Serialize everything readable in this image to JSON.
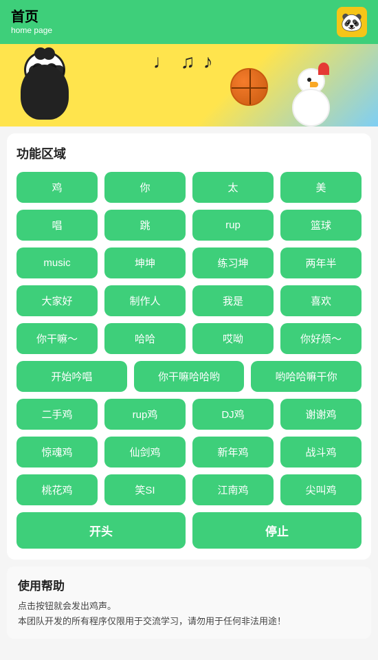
{
  "header": {
    "title_zh": "首页",
    "subtitle": "home page",
    "logo_emoji": "🐼"
  },
  "function_section": {
    "title": "功能区域",
    "rows": [
      {
        "cols": 4,
        "buttons": [
          "鸡",
          "你",
          "太",
          "美"
        ]
      },
      {
        "cols": 4,
        "buttons": [
          "唱",
          "跳",
          "rup",
          "篮球"
        ]
      },
      {
        "cols": 4,
        "buttons": [
          "music",
          "坤坤",
          "练习坤",
          "两年半"
        ]
      },
      {
        "cols": 4,
        "buttons": [
          "大家好",
          "制作人",
          "我是",
          "喜欢"
        ]
      },
      {
        "cols": 4,
        "buttons": [
          "你干嘛～",
          "哈哈",
          "哎呦",
          "你好烦～"
        ]
      },
      {
        "cols": 3,
        "buttons": [
          "开始吟唱",
          "你干嘛哈哈哟",
          "哟哈哈嘛干你"
        ]
      },
      {
        "cols": 4,
        "buttons": [
          "二手鸡",
          "rup鸡",
          "DJ鸡",
          "谢谢鸡"
        ]
      },
      {
        "cols": 4,
        "buttons": [
          "惊魂鸡",
          "仙剑鸡",
          "新年鸡",
          "战斗鸡"
        ]
      },
      {
        "cols": 4,
        "buttons": [
          "桃花鸡",
          "笑SI",
          "江南鸡",
          "尖叫鸡"
        ]
      }
    ],
    "bottom_buttons": [
      "开头",
      "停止"
    ]
  },
  "help_section": {
    "title": "使用帮助",
    "lines": [
      "点击按钮就会发出鸡声。",
      "本团队开发的所有程序仅限用于交流学习，请勿用于任何非法用途！"
    ]
  }
}
